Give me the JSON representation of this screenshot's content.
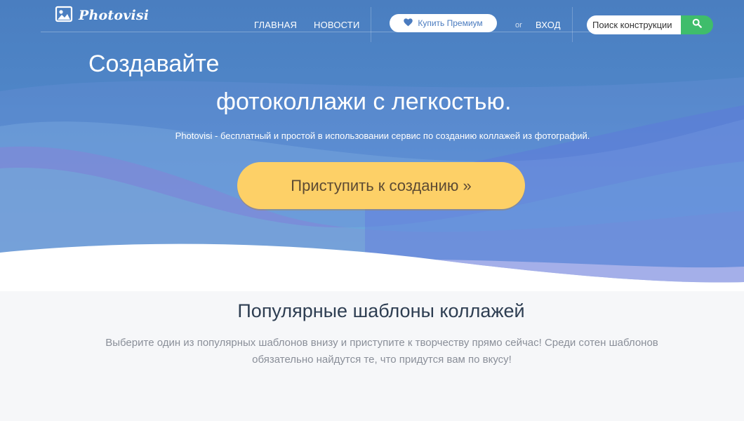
{
  "brand": {
    "name": "Photovisi"
  },
  "nav": {
    "items": [
      {
        "label": "ГЛАВНАЯ"
      },
      {
        "label": "НОВОСТИ"
      }
    ],
    "premium_label": "Купить Премиум",
    "or_text": "or",
    "login_label": "ВХОД",
    "search": {
      "placeholder": "Поиск конструкции"
    }
  },
  "hero": {
    "title_line1": "Создавайте",
    "title_line2": "фотоколлажи с легкостью.",
    "subtitle": "Photovisi - бесплатный и простой в использовании сервис по созданию коллажей из фотографий.",
    "cta_label": "Приступить к созданию »"
  },
  "templates_section": {
    "title": "Популярные шаблоны коллажей",
    "description": "Выберите один из популярных шаблонов внизу и приступите к творчеству прямо сейчас! Среди сотен шаблонов обязательно найдутся те, что придутся вам по вкусу!"
  },
  "colors": {
    "hero_blue": "#4f86c8",
    "cta_yellow": "#fdd067",
    "search_green": "#3fbd6b",
    "heading_dark": "#2e3e52",
    "body_gray": "#8a8f99"
  },
  "icons": {
    "logo": "photo-frame-icon",
    "premium": "heart-icon",
    "search": "magnifier-icon"
  }
}
